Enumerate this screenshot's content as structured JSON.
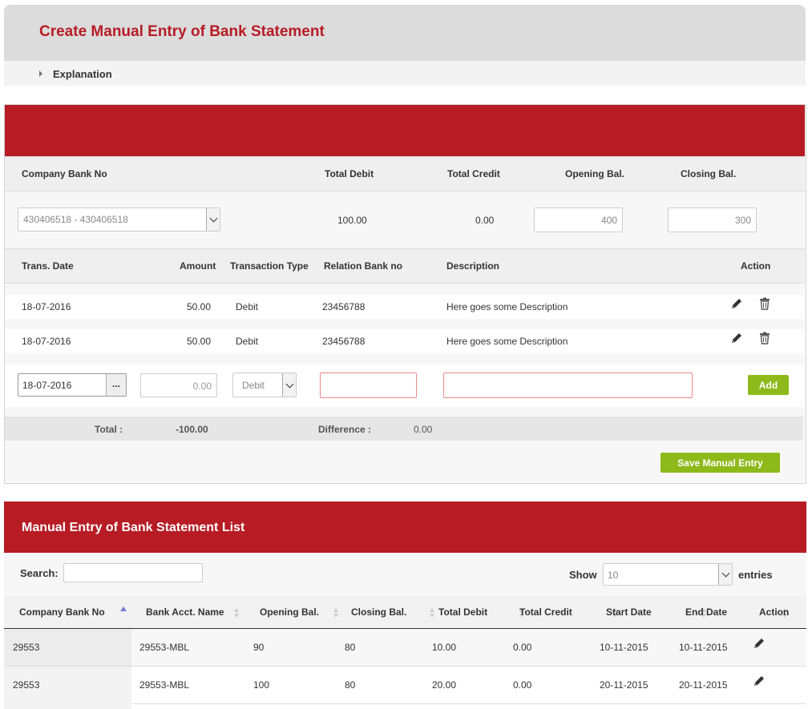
{
  "page": {
    "title": "Create Manual Entry of Bank Statement",
    "explanation": "Explanation"
  },
  "summary": {
    "headers": {
      "company_bank_no": "Company Bank No",
      "total_debit": "Total Debit",
      "total_credit": "Total Credit",
      "opening_bal": "Opening Bal.",
      "closing_bal": "Closing Bal."
    },
    "company_bank_value": "430406518 - 430406518",
    "total_debit": "100.00",
    "total_credit": "0.00",
    "opening_bal": "400",
    "closing_bal": "300"
  },
  "entries": {
    "headers": {
      "trans_date": "Trans. Date",
      "amount": "Amount",
      "transaction_type": "Transaction Type",
      "relation_bank_no": "Relation Bank no",
      "description": "Description",
      "action": "Action"
    },
    "rows": [
      {
        "date": "18-07-2016",
        "amount": "50.00",
        "type": "Debit",
        "relation": "23456788",
        "description": "Here goes some Description"
      },
      {
        "date": "18-07-2016",
        "amount": "50.00",
        "type": "Debit",
        "relation": "23456788",
        "description": "Here goes some Description"
      }
    ],
    "new_entry": {
      "date": "18-07-2016",
      "date_button": "...",
      "amount_placeholder": "0.00",
      "type": "Debit",
      "add_label": "Add"
    },
    "totals": {
      "total_label": "Total :",
      "total_value": "-100.00",
      "difference_label": "Difference :",
      "difference_value": "0.00"
    },
    "save_label": "Save Manual Entry"
  },
  "list": {
    "title": "Manual Entry of Bank Statement List",
    "search_label": "Search:",
    "search_value": "",
    "show_label": "Show",
    "show_value": "10",
    "entries_label": "entries",
    "columns": [
      "Company Bank No",
      "Bank Acct. Name",
      "Opening Bal.",
      "Closing Bal.",
      "Total Debit",
      "Total Credit",
      "Start Date",
      "End Date",
      "Action"
    ],
    "rows": [
      [
        "29553",
        "29553-MBL",
        "90",
        "80",
        "10.00",
        "0.00",
        "10-11-2015",
        "10-11-2015"
      ],
      [
        "29553",
        "29553-MBL",
        "100",
        "80",
        "20.00",
        "0.00",
        "20-11-2015",
        "20-11-2015"
      ]
    ]
  },
  "colors": {
    "brand_red": "#b71c24",
    "action_green": "#8dba1a"
  }
}
